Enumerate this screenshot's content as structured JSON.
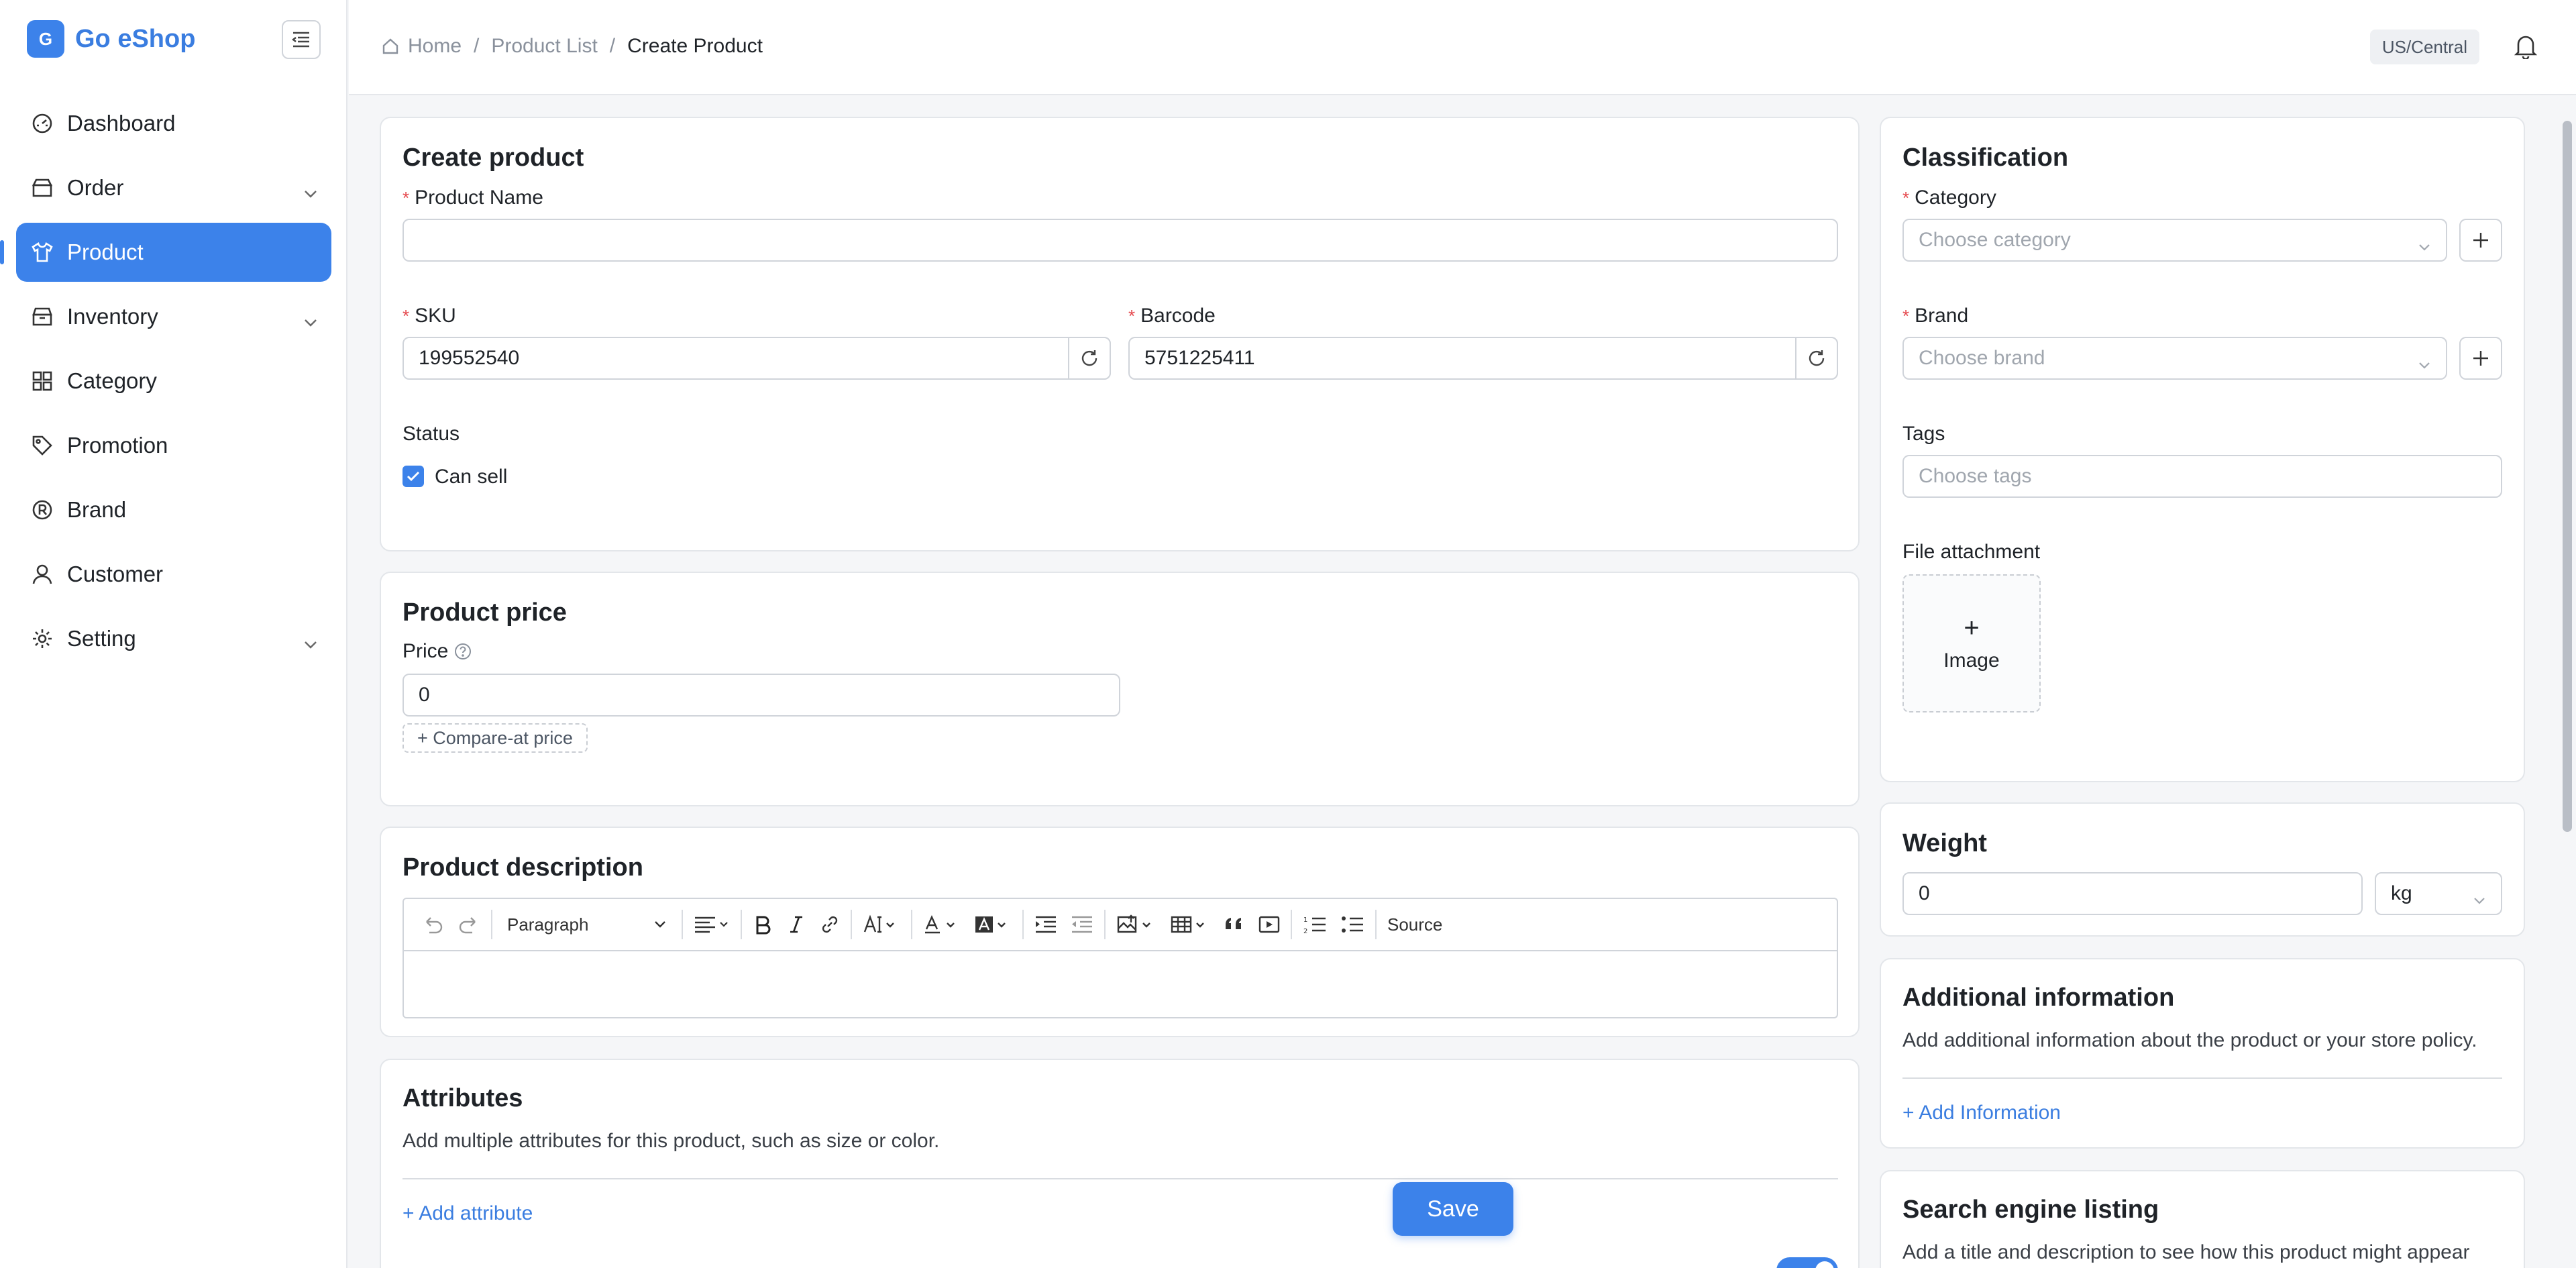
{
  "brand": {
    "badge": "G",
    "name": "Go eShop"
  },
  "sidebar": {
    "items": [
      {
        "label": "Dashboard"
      },
      {
        "label": "Order"
      },
      {
        "label": "Product"
      },
      {
        "label": "Inventory"
      },
      {
        "label": "Category"
      },
      {
        "label": "Promotion"
      },
      {
        "label": "Brand"
      },
      {
        "label": "Customer"
      },
      {
        "label": "Setting"
      }
    ]
  },
  "header": {
    "breadcrumb": [
      "Home",
      "Product List",
      "Create Product"
    ],
    "timezone": "US/Central"
  },
  "create_product": {
    "title": "Create product",
    "product_name_label": "Product Name",
    "product_name_value": "",
    "sku_label": "SKU",
    "sku_value": "199552540",
    "barcode_label": "Barcode",
    "barcode_value": "5751225411",
    "status_label": "Status",
    "can_sell_label": "Can sell"
  },
  "price": {
    "title": "Product price",
    "price_label": "Price",
    "price_value": "0",
    "compare_label": "+ Compare-at price"
  },
  "description": {
    "title": "Product description",
    "paragraph_label": "Paragraph",
    "source_label": "Source"
  },
  "attributes": {
    "title": "Attributes",
    "subtitle": "Add multiple attributes for this product, such as size or color.",
    "add_label": "+ Add attribute"
  },
  "classification": {
    "title": "Classification",
    "category_label": "Category",
    "category_placeholder": "Choose category",
    "brand_label": "Brand",
    "brand_placeholder": "Choose brand",
    "tags_label": "Tags",
    "tags_placeholder": "Choose tags",
    "attachment_label": "File attachment",
    "upload_plus": "+",
    "upload_label": "Image"
  },
  "weight": {
    "title": "Weight",
    "value": "0",
    "unit": "kg"
  },
  "additional": {
    "title": "Additional information",
    "subtitle": "Add additional information about the product or your store policy.",
    "add_label": "+ Add Information"
  },
  "seo": {
    "title": "Search engine listing",
    "subtitle": "Add a title and description to see how this product might appear"
  },
  "save_label": "Save",
  "colors": {
    "accent": "#3c82ea",
    "required": "#e5484d"
  }
}
